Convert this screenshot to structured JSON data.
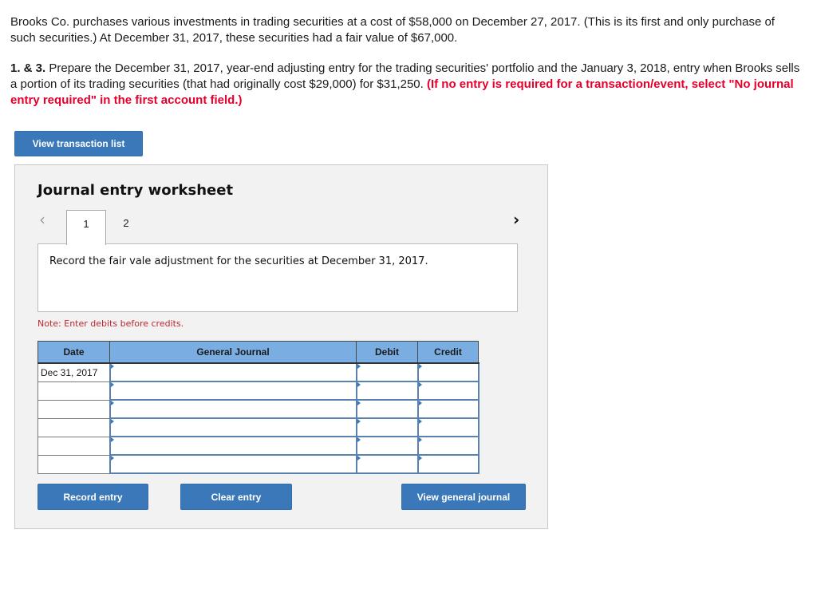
{
  "intro": {
    "paragraph": "Brooks Co. purchases various investments in trading securities at a cost of $58,000 on December 27, 2017. (This is its first and only purchase of such securities.) At December 31, 2017, these securities had a fair value of $67,000.",
    "question_number": "1. & 3.",
    "question_text": " Prepare the December 31, 2017, year-end adjusting entry for the trading securities' portfolio and the January 3, 2018, entry when Brooks sells a portion of its trading securities (that had originally cost $29,000) for $31,250. ",
    "question_instruction": "(If no entry is required for a transaction/event, select \"No journal entry required\" in the first account field.)"
  },
  "buttons": {
    "view_transaction_list": "View transaction list",
    "record_entry": "Record entry",
    "clear_entry": "Clear entry",
    "view_general_journal": "View general journal"
  },
  "worksheet": {
    "title": "Journal entry worksheet",
    "prev_icon": "‹",
    "next_icon": "›",
    "tabs": [
      {
        "label": "1",
        "active": true
      },
      {
        "label": "2",
        "active": false
      }
    ],
    "instruction": "Record the fair vale adjustment for the securities at December 31, 2017.",
    "note": "Note: Enter debits before credits.",
    "table": {
      "headers": [
        "Date",
        "General Journal",
        "Debit",
        "Credit"
      ],
      "rows": [
        {
          "date": "Dec 31, 2017",
          "account": "",
          "debit": "",
          "credit": ""
        },
        {
          "date": "",
          "account": "",
          "debit": "",
          "credit": ""
        },
        {
          "date": "",
          "account": "",
          "debit": "",
          "credit": ""
        },
        {
          "date": "",
          "account": "",
          "debit": "",
          "credit": ""
        },
        {
          "date": "",
          "account": "",
          "debit": "",
          "credit": ""
        },
        {
          "date": "",
          "account": "",
          "debit": "",
          "credit": ""
        }
      ]
    }
  },
  "colors": {
    "button_blue": "#3b78b9",
    "header_blue": "#7aaee3",
    "alert_red": "#e4002b",
    "note_red": "#c0272d"
  }
}
